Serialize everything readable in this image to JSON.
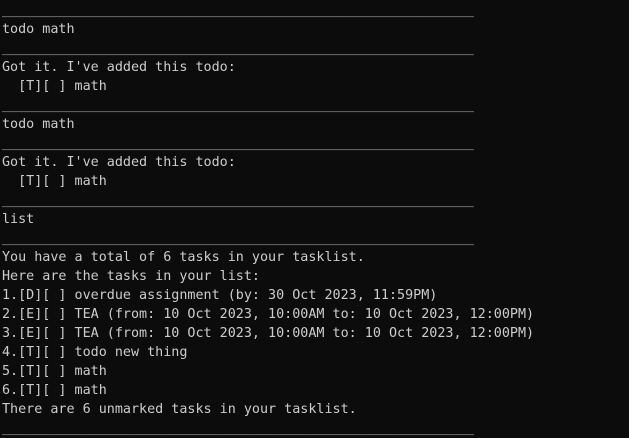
{
  "terminal": {
    "lines": [
      "____________________________________________________________",
      "todo math",
      "____________________________________________________________",
      "Got it. I've added this todo:",
      "  [T][ ] math",
      "____________________________________________________________",
      "todo math",
      "____________________________________________________________",
      "Got it. I've added this todo:",
      "  [T][ ] math",
      "____________________________________________________________",
      "list",
      "____________________________________________________________",
      "You have a total of 6 tasks in your tasklist.",
      "Here are the tasks in your list:",
      "1.[D][ ] overdue assignment (by: 30 Oct 2023, 11:59PM)",
      "2.[E][ ] TEA (from: 10 Oct 2023, 10:00AM to: 10 Oct 2023, 12:00PM)",
      "3.[E][ ] TEA (from: 10 Oct 2023, 10:00AM to: 10 Oct 2023, 12:00PM)",
      "4.[T][ ] todo new thing",
      "5.[T][ ] math",
      "6.[T][ ] math",
      "There are 6 unmarked tasks in your tasklist.",
      "____________________________________________________________"
    ]
  }
}
